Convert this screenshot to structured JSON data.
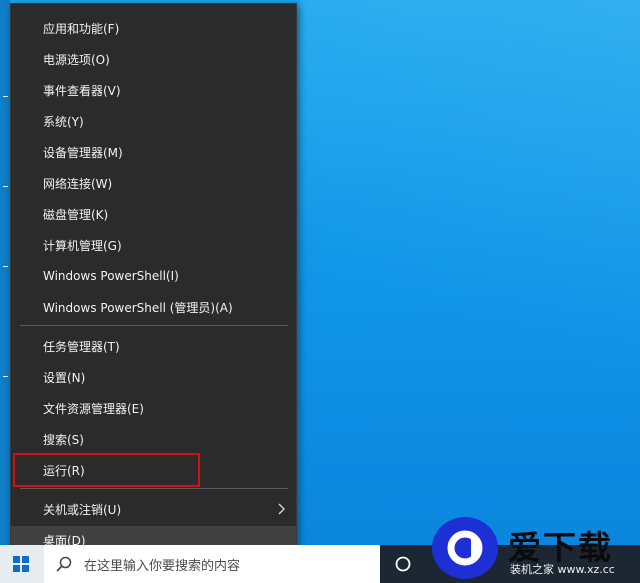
{
  "desktop": {
    "background_color": "#1aa7ee"
  },
  "context_menu": {
    "groups": [
      [
        {
          "label": "应用和功能(F)"
        },
        {
          "label": "电源选项(O)"
        },
        {
          "label": "事件查看器(V)"
        },
        {
          "label": "系统(Y)"
        },
        {
          "label": "设备管理器(M)"
        },
        {
          "label": "网络连接(W)"
        },
        {
          "label": "磁盘管理(K)"
        },
        {
          "label": "计算机管理(G)"
        },
        {
          "label": "Windows PowerShell(I)"
        },
        {
          "label": "Windows PowerShell (管理员)(A)"
        }
      ],
      [
        {
          "label": "任务管理器(T)"
        },
        {
          "label": "设置(N)"
        },
        {
          "label": "文件资源管理器(E)"
        },
        {
          "label": "搜索(S)"
        },
        {
          "label": "运行(R)",
          "highlighted": true
        }
      ],
      [
        {
          "label": "关机或注销(U)",
          "has_submenu": true
        },
        {
          "label": "桌面(D)",
          "hovered": true
        }
      ]
    ],
    "submenu_arrow_icon": "chevron-right-icon",
    "highlight_color": "#d0111b"
  },
  "taskbar": {
    "start_icon": "windows-start-icon",
    "search_placeholder": "在这里输入你要搜索的内容",
    "search_icon": "search-icon",
    "task_view_icon": "task-view-icon"
  },
  "watermark": {
    "logo_icon": "e-logo-icon",
    "text": "爱下载",
    "sub_text": "装机之家 www.xz.cc"
  }
}
